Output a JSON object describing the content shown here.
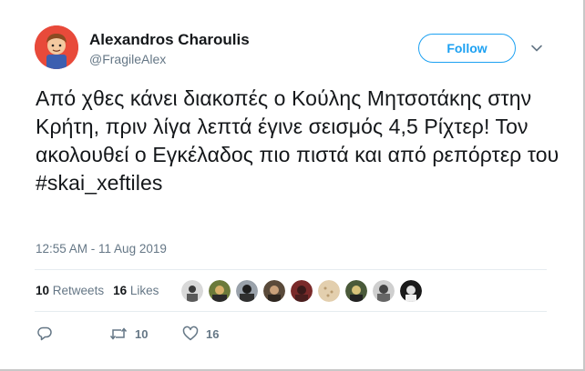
{
  "user": {
    "display_name": "Alexandros Charoulis",
    "handle": "@FragileAlex"
  },
  "follow_label": "Follow",
  "tweet": {
    "text_main": "Από χθες κάνει διακοπές ο Κούλης Μητσοτάκης στην Κρήτη, πριν λίγα λεπτά έγινε σεισμός 4,5 Ρίχτερ! Τον ακολουθεί ο Εγκέλαδος πιο πιστά και από ρεπόρτερ του",
    "hashtag": "#skai_xeftiles",
    "timestamp": "12:55 AM - 11 Aug 2019"
  },
  "stats": {
    "retweets_count": "10",
    "retweets_label": "Retweets",
    "likes_count": "16",
    "likes_label": "Likes"
  },
  "actions": {
    "retweet_count": "10",
    "like_count": "16"
  },
  "colors": {
    "accent": "#1da1f2",
    "muted": "#657786",
    "text": "#14171a",
    "divider": "#e6ecf0"
  }
}
